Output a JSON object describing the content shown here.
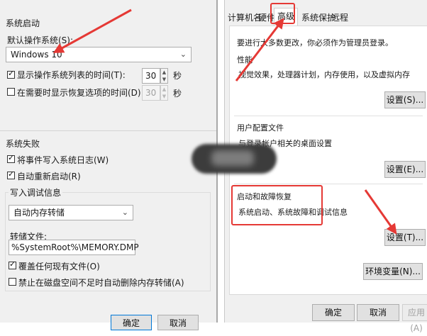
{
  "colors": {
    "annotation_red": "#e53935",
    "default_button_border": "#0078d7",
    "dialog_bg": "#f0f0f0"
  },
  "startup_dialog": {
    "system_startup": {
      "heading": "系统启动",
      "default_os_label": "默认操作系统(S):",
      "default_os_value": "Windows 10",
      "show_os_list": {
        "label": "显示操作系统列表的时间(T):",
        "checked": true,
        "value": "30",
        "unit": "秒"
      },
      "show_recovery": {
        "label": "在需要时显示恢复选项的时间(D):",
        "checked": false,
        "value": "30",
        "unit": "秒"
      }
    },
    "system_failure": {
      "heading": "系统失败",
      "write_event": {
        "label": "将事件写入系统日志(W)",
        "checked": true
      },
      "auto_restart": {
        "label": "自动重新启动(R)",
        "checked": true
      },
      "debug_heading": "写入调试信息",
      "debug_value": "自动内存转储",
      "dump_file_label": "转储文件:",
      "dump_file_value": "%SystemRoot%\\MEMORY.DMP",
      "overwrite": {
        "label": "覆盖任何现有文件(O)",
        "checked": true
      },
      "disable_low_disk": {
        "label": "禁止在磁盘空间不足时自动删除内存转储(A)",
        "checked": false
      }
    },
    "buttons": {
      "ok": "确定",
      "cancel": "取消"
    }
  },
  "system_properties": {
    "tabs": [
      {
        "label": "计算机名",
        "active": false
      },
      {
        "label": "硬件",
        "active": false
      },
      {
        "label": "高级",
        "active": true
      },
      {
        "label": "系统保护",
        "active": false
      },
      {
        "label": "远程",
        "active": false
      }
    ],
    "admin_note": "要进行大多数更改，你必须作为管理员登录。",
    "performance": {
      "heading": "性能",
      "desc": "视觉效果，处理器计划，内存使用，以及虚拟内存",
      "button": "设置(S)..."
    },
    "user_profiles": {
      "heading": "用户配置文件",
      "desc": "与登录帐户相关的桌面设置",
      "button": "设置(E)..."
    },
    "startup_recovery": {
      "heading": "启动和故障恢复",
      "desc": "系统启动、系统故障和调试信息",
      "button": "设置(T)..."
    },
    "env_button": "环境变量(N)...",
    "footer": {
      "ok": "确定",
      "cancel": "取消",
      "apply": "应用(A)"
    }
  }
}
